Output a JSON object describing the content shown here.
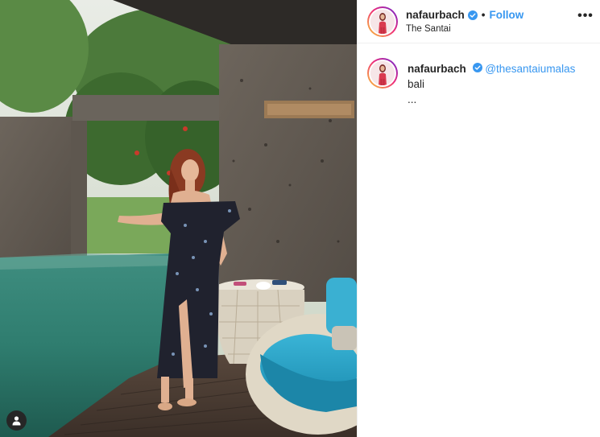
{
  "post": {
    "username": "nafaurbach",
    "separator": "•",
    "follow_label": "Follow",
    "location": "The Santai",
    "more_icon": "more-options-icon",
    "more_label": "•••"
  },
  "caption": {
    "username": "nafaurbach",
    "mention": "@thesantaiumalas",
    "text": " bali",
    "ellipsis": "..."
  },
  "icons": {
    "verified": "verified-badge-icon",
    "user_tag": "user-tag-icon"
  },
  "colors": {
    "link_blue": "#3897f0",
    "verified_blue": "#3897f0",
    "text": "#262626",
    "divider": "#efefef"
  }
}
